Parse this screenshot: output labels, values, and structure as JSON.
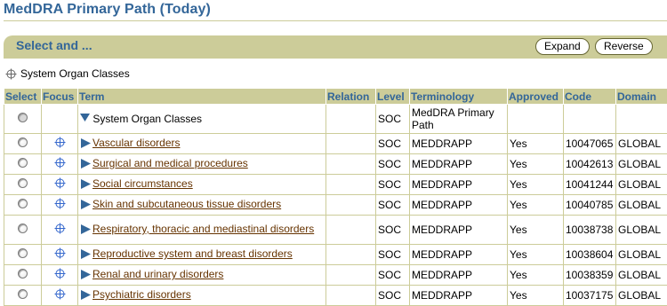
{
  "page": {
    "title": "MedDRA Primary Path (Today)"
  },
  "select_bar": {
    "title": "Select and ...",
    "expand_label": "Expand",
    "reverse_label": "Reverse"
  },
  "breadcrumb": {
    "label": "System Organ Classes"
  },
  "table": {
    "headers": {
      "select": "Select",
      "focus": "Focus",
      "term": "Term",
      "relation": "Relation",
      "level": "Level",
      "terminology": "Terminology",
      "approved": "Approved",
      "code": "Code",
      "domain": "Domain"
    },
    "root": {
      "term": "System Organ Classes",
      "level": "SOC",
      "terminology": "MedDRA Primary Path"
    },
    "rows": [
      {
        "term": "Vascular disorders",
        "level": "SOC",
        "terminology": "MEDDRAPP",
        "approved": "Yes",
        "code": "10047065",
        "domain": "GLOBAL"
      },
      {
        "term": "Surgical and medical procedures",
        "level": "SOC",
        "terminology": "MEDDRAPP",
        "approved": "Yes",
        "code": "10042613",
        "domain": "GLOBAL"
      },
      {
        "term": "Social circumstances",
        "level": "SOC",
        "terminology": "MEDDRAPP",
        "approved": "Yes",
        "code": "10041244",
        "domain": "GLOBAL"
      },
      {
        "term": "Skin and subcutaneous tissue disorders",
        "level": "SOC",
        "terminology": "MEDDRAPP",
        "approved": "Yes",
        "code": "10040785",
        "domain": "GLOBAL"
      },
      {
        "term": "Respiratory, thoracic and mediastinal disorders",
        "level": "SOC",
        "terminology": "MEDDRAPP",
        "approved": "Yes",
        "code": "10038738",
        "domain": "GLOBAL"
      },
      {
        "term": "Reproductive system and breast disorders",
        "level": "SOC",
        "terminology": "MEDDRAPP",
        "approved": "Yes",
        "code": "10038604",
        "domain": "GLOBAL"
      },
      {
        "term": "Renal and urinary disorders",
        "level": "SOC",
        "terminology": "MEDDRAPP",
        "approved": "Yes",
        "code": "10038359",
        "domain": "GLOBAL"
      },
      {
        "term": "Psychiatric disorders",
        "level": "SOC",
        "terminology": "MEDDRAPP",
        "approved": "Yes",
        "code": "10037175",
        "domain": "GLOBAL"
      }
    ]
  },
  "colors": {
    "title_blue": "#336699",
    "header_bg": "#cccc99",
    "link_brown": "#663300",
    "triangle_blue": "#336699"
  }
}
